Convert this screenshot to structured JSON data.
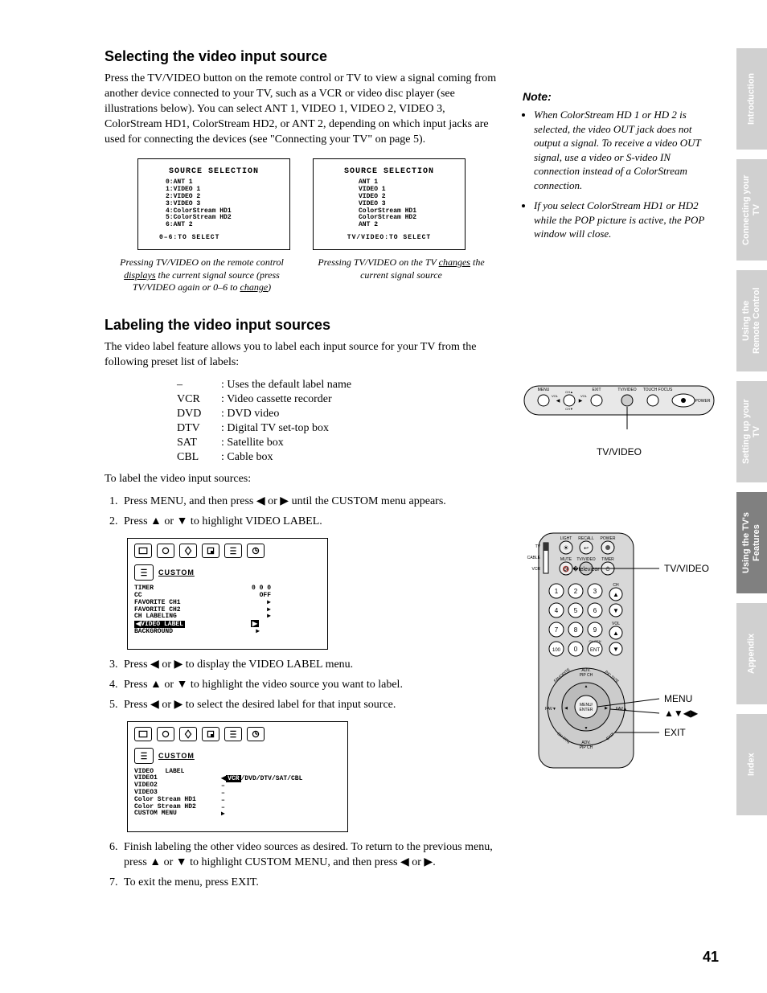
{
  "page_number": "41",
  "section1": {
    "heading": "Selecting the video input source",
    "para": "Press the TV/VIDEO button on the remote control or TV to view a signal coming from another device connected to your TV, such as a VCR or video disc player (see illustrations below). You can select ANT 1, VIDEO 1, VIDEO 2, VIDEO 3, ColorStream HD1, ColorStream HD2, or ANT 2, depending on which input jacks are used for connecting the devices (see \"Connecting your TV\" on page 5)."
  },
  "osd_left": {
    "title": "SOURCE SELECTION",
    "lines": "0:ANT 1\n1:VIDEO 1\n2:VIDEO 2\n3:VIDEO 3\n4:ColorStream HD1\n5:ColorStream HD2\n6:ANT 2",
    "foot": "0–6:TO SELECT",
    "caption_pre": "Pressing TV/VIDEO on the remote control ",
    "caption_u": "displays",
    "caption_post": " the current signal source (press TV/VIDEO again or 0–6 to ",
    "caption_u2": "change",
    "caption_end": ")"
  },
  "osd_right": {
    "title": "SOURCE SELECTION",
    "lines": "ANT 1\nVIDEO 1\nVIDEO 2\nVIDEO 3\nColorStream HD1\nColorStream HD2\nANT 2",
    "foot": "TV/VIDEO:TO SELECT",
    "caption_pre": "Pressing TV/VIDEO on the TV ",
    "caption_u": "changes",
    "caption_post": " the current signal source"
  },
  "section2": {
    "heading": "Labeling the video input sources",
    "para": "The video label feature allows you to label each input source for your TV from the following preset list of labels:",
    "labels": [
      {
        "k": "–",
        "v": ": Uses the default label name"
      },
      {
        "k": "VCR",
        "v": ": Video cassette recorder"
      },
      {
        "k": "DVD",
        "v": ": DVD video"
      },
      {
        "k": "DTV",
        "v": ": Digital TV set-top box"
      },
      {
        "k": "SAT",
        "v": ": Satellite box"
      },
      {
        "k": "CBL",
        "v": ": Cable box"
      }
    ],
    "lead": "To label the video input sources:",
    "steps": [
      "Press MENU, and then press ◀ or ▶ until the CUSTOM menu appears.",
      "Press ▲ or ▼ to highlight VIDEO LABEL.",
      "Press ◀ or ▶ to display the VIDEO LABEL menu.",
      "Press ▲ or ▼ to highlight the video source you want to label.",
      "Press ◀ or ▶ to select the desired label for that input source.",
      "Finish labeling the other video sources as desired. To return to the previous menu, press ▲ or ▼ to highlight CUSTOM MENU, and then press ◀ or ▶.",
      "To exit the menu, press EXIT."
    ]
  },
  "menu1": {
    "custom": "CUSTOM",
    "lines_left": "TIMER\nCC\nFAVORITE CH1\nFAVORITE CH2\nCH LABELING",
    "lines_right": "0 0 0\nOFF\n▶\n▶\n▶",
    "highlight": "VIDEO LABEL",
    "hl_right": "▶",
    "after": "BACKGROUND",
    "after_right": "▶"
  },
  "menu2": {
    "custom": "CUSTOM",
    "title_line": "VIDEO   LABEL",
    "rows_left": "VIDEO1\nVIDEO2\nVIDEO3\nColor Stream HD1\nColor Stream HD2\nCUSTOM MENU",
    "row1_right_hl": "VCR",
    "row1_right_rest": "/DVD/DTV/SAT/CBL",
    "rows_right": "–\n–\n–\n–\n▶"
  },
  "note": {
    "title": "Note:",
    "items": [
      "When ColorStream HD 1 or HD 2 is selected, the video OUT jack does not output a signal. To receive a video OUT signal, use a video or S-video IN connection instead of a ColorStream connection.",
      "If you select ColorStream HD1 or HD2 while the POP picture is active, the POP window will close."
    ]
  },
  "panel": {
    "caption": "TV/VIDEO",
    "buttons": [
      "MENU",
      "VOL◀",
      "CH▲",
      "VOL▶",
      "CH▼",
      "EXIT",
      "TV/VIDEO",
      "TOUCH FOCUS",
      "POWER"
    ]
  },
  "remote": {
    "callouts": [
      "TV/VIDEO",
      "MENU",
      "▲▼◀▶",
      "EXIT"
    ],
    "top_labels": [
      "LIGHT",
      "RECALL",
      "POWER",
      "MUTE",
      "TV/VIDEO",
      "TIMER"
    ],
    "side_switch": [
      "TV",
      "CABLE",
      "VCR"
    ],
    "numbers": [
      "1",
      "2",
      "3",
      "4",
      "5",
      "6",
      "7",
      "8",
      "9",
      "100",
      "0",
      "ENT"
    ],
    "side": [
      "CH",
      "▲",
      "▼",
      "VOL",
      "▲",
      "▼"
    ],
    "ring": [
      "FAVORITE",
      "ADV. PIP CH",
      "PIC SIZE",
      "FAV▼",
      "MENU/ ENTER",
      "FAV▲",
      "CH RTN",
      "ADV. PIP CH",
      "EXIT"
    ],
    "chrtn": "CH RTN"
  },
  "tabs": [
    {
      "label": "Introduction",
      "active": false
    },
    {
      "label": "Connecting your TV",
      "active": false
    },
    {
      "label": "Using the Remote Control",
      "active": false
    },
    {
      "label": "Setting up your TV",
      "active": false
    },
    {
      "label": "Using the TV's Features",
      "active": true
    },
    {
      "label": "Appendix",
      "active": false
    },
    {
      "label": "Index",
      "active": false
    }
  ]
}
